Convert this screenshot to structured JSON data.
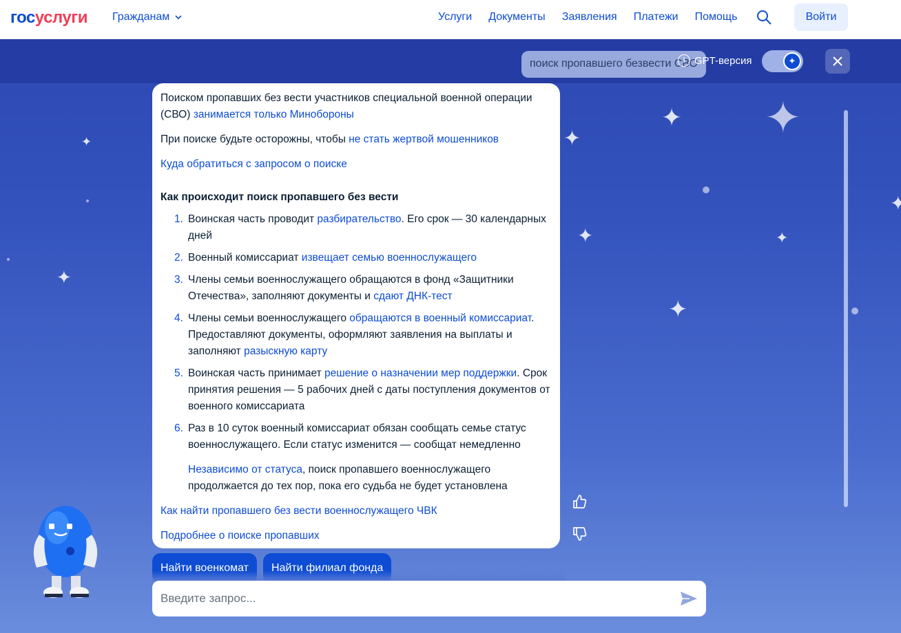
{
  "header": {
    "logo_part1": "гос",
    "logo_part2": "услуги",
    "citizens_label": "Гражданам",
    "nav": [
      "Услуги",
      "Документы",
      "Заявления",
      "Платежи",
      "Помощь"
    ],
    "login_label": "Войти"
  },
  "chat": {
    "query": "поиск пропавшего безвести СВО",
    "gpt_label": "GPT-версия",
    "p1_text": "Поиском пропавших без вести участников специальной военной операции (СВО) ",
    "p1_link": "занимается только Минобороны",
    "p2_text": "При поиске будьте осторожны, чтобы ",
    "p2_link": "не стать жертвой мошенников",
    "p3_link": "Куда обратиться с запросом о поиске",
    "heading": "Как происходит поиск пропавшего без вести",
    "steps": [
      {
        "num": "1.",
        "pre": "Воинская часть проводит ",
        "link": "разбирательство",
        "post": ". Его срок — 30 календарных дней"
      },
      {
        "num": "2.",
        "pre": "Военный комиссариат ",
        "link": "извещает семью военнослужащего",
        "post": ""
      },
      {
        "num": "3.",
        "pre": "Члены семьи военнослужащего обращаются в фонд «Защитники Отечества», заполняют документы и ",
        "link": "сдают ДНК-тест",
        "post": ""
      },
      {
        "num": "4.",
        "pre": "Члены семьи военнослужащего ",
        "link": "обращаются в военный комиссариат",
        "post": ". Предоставляют документы, оформляют заявления на выплаты и заполняют ",
        "link2": "разыскную карту"
      },
      {
        "num": "5.",
        "pre": "Воинская часть принимает ",
        "link": "решение о назначении мер поддержки",
        "post": ". Срок принятия решения — 5 рабочих дней с даты поступления документов от военного комиссариата"
      },
      {
        "num": "6.",
        "pre": "Раз в 10 суток военный комиссариат обязан сообщать семье статус военнослужащего. Если статус изменится — сообщат немедленно",
        "link": "",
        "post": ""
      }
    ],
    "note_link": "Независимо от статуса",
    "note_text": ", поиск пропавшего военнослужащего продолжается до тех пор, пока его судьба не будет установлена",
    "link_pmc": "Как найти пропавшего без вести военнослужащего ЧВК",
    "link_more": "Подробнее о поиске пропавших",
    "quick_buttons": [
      "Найти военкомат",
      "Найти филиал фонда"
    ],
    "input_placeholder": "Введите запрос..."
  }
}
